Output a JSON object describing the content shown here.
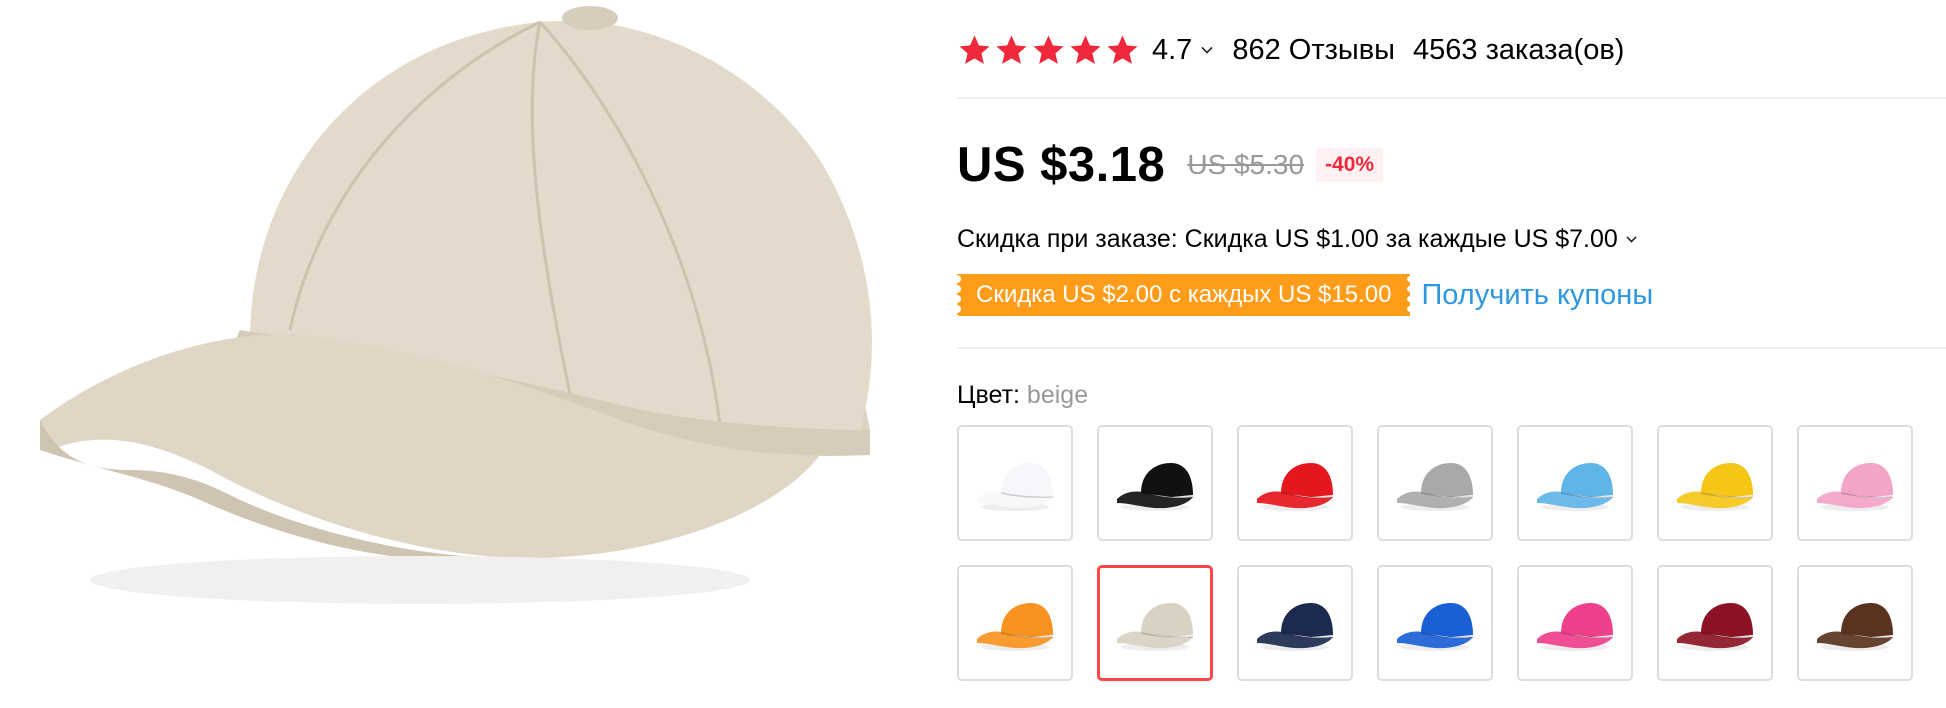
{
  "product": {
    "rating": {
      "stars_filled": 5,
      "value": "4.7",
      "reviews": "862 Отзывы",
      "orders": "4563 заказа(ов)",
      "star_color": "#f0283b"
    },
    "price": {
      "current": "US $3.18",
      "original": "US $5.30",
      "discount": "-40%"
    },
    "store_discount": "Скидка при заказе: Скидка US $1.00 за каждые US $7.00",
    "coupon": {
      "tag": "Скидка US $2.00 с каждых US $15.00",
      "link": "Получить купоны",
      "tag_color": "#ff9c1a",
      "link_color": "#2d98e0"
    },
    "color": {
      "label": "Цвет: ",
      "selected": "beige",
      "swatches": [
        {
          "hex": "#f7f7fb",
          "selected": false
        },
        {
          "hex": "#111111",
          "selected": false
        },
        {
          "hex": "#e5161d",
          "selected": false
        },
        {
          "hex": "#a9a9a9",
          "selected": false
        },
        {
          "hex": "#5fb4e8",
          "selected": false
        },
        {
          "hex": "#f5c518",
          "selected": false
        },
        {
          "hex": "#f4a3c9",
          "selected": false
        },
        {
          "hex": "#f7931e",
          "selected": false
        },
        {
          "hex": "#d9d1c2",
          "selected": true
        },
        {
          "hex": "#1b2a4e",
          "selected": false
        },
        {
          "hex": "#1a5fd6",
          "selected": false
        },
        {
          "hex": "#ee3f8b",
          "selected": false
        },
        {
          "hex": "#8c1325",
          "selected": false
        },
        {
          "hex": "#5a3320",
          "selected": false
        }
      ]
    }
  }
}
